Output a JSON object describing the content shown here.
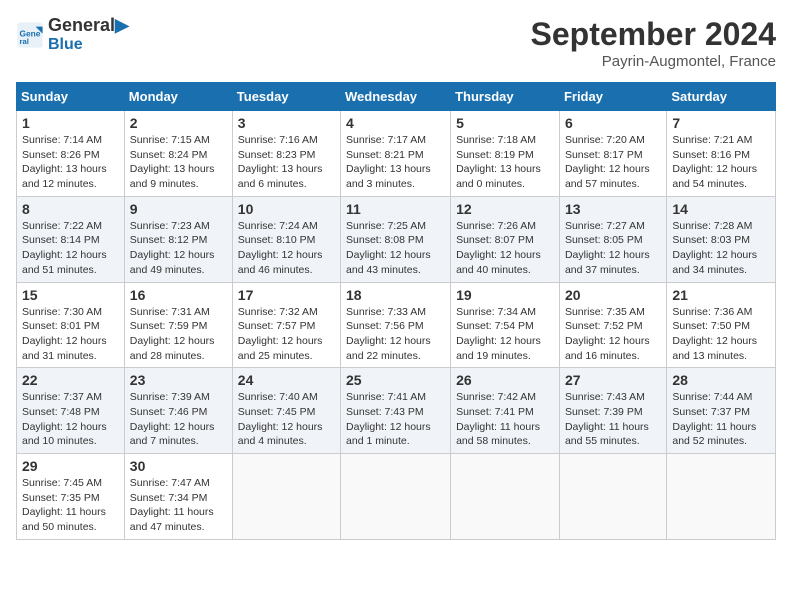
{
  "logo": {
    "line1": "General",
    "line2": "Blue"
  },
  "title": "September 2024",
  "location": "Payrin-Augmontel, France",
  "days_of_week": [
    "Sunday",
    "Monday",
    "Tuesday",
    "Wednesday",
    "Thursday",
    "Friday",
    "Saturday"
  ],
  "weeks": [
    [
      {
        "day": "1",
        "info": "Sunrise: 7:14 AM\nSunset: 8:26 PM\nDaylight: 13 hours\nand 12 minutes."
      },
      {
        "day": "2",
        "info": "Sunrise: 7:15 AM\nSunset: 8:24 PM\nDaylight: 13 hours\nand 9 minutes."
      },
      {
        "day": "3",
        "info": "Sunrise: 7:16 AM\nSunset: 8:23 PM\nDaylight: 13 hours\nand 6 minutes."
      },
      {
        "day": "4",
        "info": "Sunrise: 7:17 AM\nSunset: 8:21 PM\nDaylight: 13 hours\nand 3 minutes."
      },
      {
        "day": "5",
        "info": "Sunrise: 7:18 AM\nSunset: 8:19 PM\nDaylight: 13 hours\nand 0 minutes."
      },
      {
        "day": "6",
        "info": "Sunrise: 7:20 AM\nSunset: 8:17 PM\nDaylight: 12 hours\nand 57 minutes."
      },
      {
        "day": "7",
        "info": "Sunrise: 7:21 AM\nSunset: 8:16 PM\nDaylight: 12 hours\nand 54 minutes."
      }
    ],
    [
      {
        "day": "8",
        "info": "Sunrise: 7:22 AM\nSunset: 8:14 PM\nDaylight: 12 hours\nand 51 minutes."
      },
      {
        "day": "9",
        "info": "Sunrise: 7:23 AM\nSunset: 8:12 PM\nDaylight: 12 hours\nand 49 minutes."
      },
      {
        "day": "10",
        "info": "Sunrise: 7:24 AM\nSunset: 8:10 PM\nDaylight: 12 hours\nand 46 minutes."
      },
      {
        "day": "11",
        "info": "Sunrise: 7:25 AM\nSunset: 8:08 PM\nDaylight: 12 hours\nand 43 minutes."
      },
      {
        "day": "12",
        "info": "Sunrise: 7:26 AM\nSunset: 8:07 PM\nDaylight: 12 hours\nand 40 minutes."
      },
      {
        "day": "13",
        "info": "Sunrise: 7:27 AM\nSunset: 8:05 PM\nDaylight: 12 hours\nand 37 minutes."
      },
      {
        "day": "14",
        "info": "Sunrise: 7:28 AM\nSunset: 8:03 PM\nDaylight: 12 hours\nand 34 minutes."
      }
    ],
    [
      {
        "day": "15",
        "info": "Sunrise: 7:30 AM\nSunset: 8:01 PM\nDaylight: 12 hours\nand 31 minutes."
      },
      {
        "day": "16",
        "info": "Sunrise: 7:31 AM\nSunset: 7:59 PM\nDaylight: 12 hours\nand 28 minutes."
      },
      {
        "day": "17",
        "info": "Sunrise: 7:32 AM\nSunset: 7:57 PM\nDaylight: 12 hours\nand 25 minutes."
      },
      {
        "day": "18",
        "info": "Sunrise: 7:33 AM\nSunset: 7:56 PM\nDaylight: 12 hours\nand 22 minutes."
      },
      {
        "day": "19",
        "info": "Sunrise: 7:34 AM\nSunset: 7:54 PM\nDaylight: 12 hours\nand 19 minutes."
      },
      {
        "day": "20",
        "info": "Sunrise: 7:35 AM\nSunset: 7:52 PM\nDaylight: 12 hours\nand 16 minutes."
      },
      {
        "day": "21",
        "info": "Sunrise: 7:36 AM\nSunset: 7:50 PM\nDaylight: 12 hours\nand 13 minutes."
      }
    ],
    [
      {
        "day": "22",
        "info": "Sunrise: 7:37 AM\nSunset: 7:48 PM\nDaylight: 12 hours\nand 10 minutes."
      },
      {
        "day": "23",
        "info": "Sunrise: 7:39 AM\nSunset: 7:46 PM\nDaylight: 12 hours\nand 7 minutes."
      },
      {
        "day": "24",
        "info": "Sunrise: 7:40 AM\nSunset: 7:45 PM\nDaylight: 12 hours\nand 4 minutes."
      },
      {
        "day": "25",
        "info": "Sunrise: 7:41 AM\nSunset: 7:43 PM\nDaylight: 12 hours\nand 1 minute."
      },
      {
        "day": "26",
        "info": "Sunrise: 7:42 AM\nSunset: 7:41 PM\nDaylight: 11 hours\nand 58 minutes."
      },
      {
        "day": "27",
        "info": "Sunrise: 7:43 AM\nSunset: 7:39 PM\nDaylight: 11 hours\nand 55 minutes."
      },
      {
        "day": "28",
        "info": "Sunrise: 7:44 AM\nSunset: 7:37 PM\nDaylight: 11 hours\nand 52 minutes."
      }
    ],
    [
      {
        "day": "29",
        "info": "Sunrise: 7:45 AM\nSunset: 7:35 PM\nDaylight: 11 hours\nand 50 minutes."
      },
      {
        "day": "30",
        "info": "Sunrise: 7:47 AM\nSunset: 7:34 PM\nDaylight: 11 hours\nand 47 minutes."
      },
      null,
      null,
      null,
      null,
      null
    ]
  ]
}
